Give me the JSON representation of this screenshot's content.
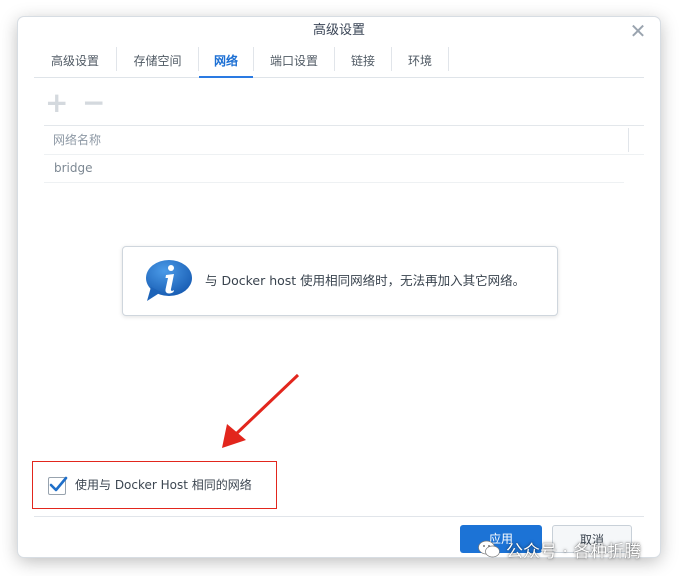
{
  "dialog": {
    "title": "高级设置",
    "close_icon": "close-icon"
  },
  "tabs": [
    {
      "label": "高级设置",
      "active": false
    },
    {
      "label": "存储空间",
      "active": false
    },
    {
      "label": "网络",
      "active": true
    },
    {
      "label": "端口设置",
      "active": false
    },
    {
      "label": "链接",
      "active": false
    },
    {
      "label": "环境",
      "active": false
    }
  ],
  "toolbar": {
    "add_icon": "plus-icon",
    "remove_icon": "minus-icon"
  },
  "table": {
    "columns": [
      "网络名称"
    ],
    "rows": [
      [
        "bridge"
      ]
    ]
  },
  "tip": {
    "icon": "info-icon",
    "text": "与 Docker host 使用相同网络时，无法再加入其它网络。"
  },
  "checkbox": {
    "checked": true,
    "label": "使用与 Docker Host 相同的网络"
  },
  "footer": {
    "apply_label": "应用",
    "cancel_label": "取消"
  },
  "watermark": {
    "text": "公众号 · 各种折腾"
  },
  "colors": {
    "accent": "#1c73d6",
    "annotation": "#e2261d"
  }
}
